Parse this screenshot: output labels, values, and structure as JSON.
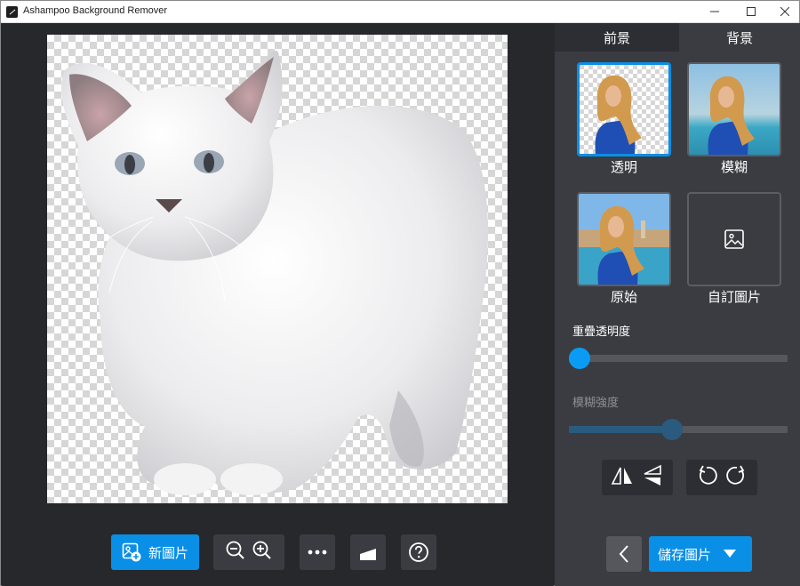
{
  "window": {
    "title": "Ashampoo Background Remover",
    "min": "—",
    "max": "☐",
    "close": "✕"
  },
  "toolbar": {
    "new_image_label": "新圖片"
  },
  "panel": {
    "tabs": [
      {
        "label": "前景"
      },
      {
        "label": "背景"
      }
    ],
    "options": [
      {
        "label": "透明",
        "selected": true
      },
      {
        "label": "模糊",
        "selected": false
      },
      {
        "label": "原始",
        "selected": false
      },
      {
        "label": "自訂圖片",
        "selected": false
      }
    ],
    "overlay_opacity": {
      "label": "重疊透明度",
      "value": 0
    },
    "blur_strength": {
      "label": "模糊強度",
      "value": 0.47,
      "enabled": false
    }
  },
  "footer": {
    "save_label": "儲存圖片"
  },
  "colors": {
    "accent": "#0a8fe6",
    "panel": "#3a3c41",
    "background": "#26282c"
  }
}
